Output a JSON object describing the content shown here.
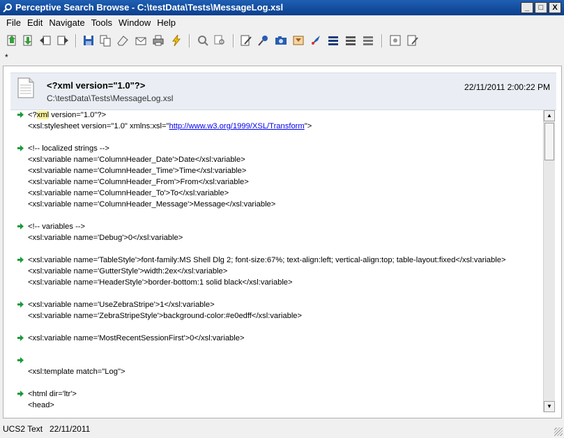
{
  "window": {
    "title": "Perceptive Search Browse - C:\\testData\\Tests\\MessageLog.xsl",
    "controls": [
      "_",
      "□",
      "X"
    ]
  },
  "menu": [
    "File",
    "Edit",
    "Navigate",
    "Tools",
    "Window",
    "Help"
  ],
  "toolbar_icons": [
    "open-icon",
    "save-arrow-icon",
    "back-icon",
    "forward-icon",
    "save-icon",
    "copy-icon",
    "eraser-icon",
    "email-icon",
    "print-icon",
    "lightning-icon",
    "search-icon",
    "find-icon",
    "edit-icon",
    "pin-icon",
    "camera-icon",
    "filter-icon",
    "rocket-icon",
    "list-icon",
    "list2-icon",
    "list3-icon",
    "image-icon",
    "notes-icon"
  ],
  "subline_text": "*",
  "document": {
    "title": "<?xml version=\"1.0\"?>",
    "path": "C:\\testData\\Tests\\MessageLog.xsl",
    "date": "22/11/2011 2:00:22 PM"
  },
  "code_lines": [
    {
      "arrow": true,
      "pre": "<?",
      "hl": "xml",
      "post": " version=\"1.0\"?>"
    },
    {
      "arrow": false,
      "pre": "<xsl:stylesheet version=\"1.0\" xmlns:xsl=\"",
      "link": "http://www.w3.org/1999/XSL/Transform",
      "post": "\">"
    },
    {
      "arrow": false,
      "pre": ""
    },
    {
      "arrow": true,
      "pre": "<!-- localized strings -->"
    },
    {
      "arrow": false,
      "pre": "<xsl:variable name='ColumnHeader_Date'>Date</xsl:variable>"
    },
    {
      "arrow": false,
      "pre": "<xsl:variable name='ColumnHeader_Time'>Time</xsl:variable>"
    },
    {
      "arrow": false,
      "pre": "<xsl:variable name='ColumnHeader_From'>From</xsl:variable>"
    },
    {
      "arrow": false,
      "pre": "<xsl:variable name='ColumnHeader_To'>To</xsl:variable>"
    },
    {
      "arrow": false,
      "pre": "<xsl:variable name='ColumnHeader_Message'>Message</xsl:variable>"
    },
    {
      "arrow": false,
      "pre": ""
    },
    {
      "arrow": true,
      "pre": "<!-- variables -->"
    },
    {
      "arrow": false,
      "pre": "<xsl:variable name='Debug'>0</xsl:variable>"
    },
    {
      "arrow": false,
      "pre": ""
    },
    {
      "arrow": true,
      "pre": "<xsl:variable name='TableStyle'>font-family:MS Shell Dlg 2; font-size:67%; text-align:left; vertical-align:top; table-layout:fixed</xsl:variable>"
    },
    {
      "arrow": false,
      "pre": "<xsl:variable name='GutterStyle'>width:2ex</xsl:variable>"
    },
    {
      "arrow": false,
      "pre": "<xsl:variable name='HeaderStyle'>border-bottom:1 solid black</xsl:variable>"
    },
    {
      "arrow": false,
      "pre": ""
    },
    {
      "arrow": true,
      "pre": "<xsl:variable name='UseZebraStripe'>1</xsl:variable>"
    },
    {
      "arrow": false,
      "pre": "<xsl:variable name='ZebraStripeStyle'>background-color:#e0edff</xsl:variable>"
    },
    {
      "arrow": false,
      "pre": ""
    },
    {
      "arrow": true,
      "pre": "<xsl:variable name='MostRecentSessionFirst'>0</xsl:variable>"
    },
    {
      "arrow": false,
      "pre": ""
    },
    {
      "arrow": true,
      "pre": ""
    },
    {
      "arrow": false,
      "pre": "<xsl:template match=\"Log\">"
    },
    {
      "arrow": false,
      "pre": ""
    },
    {
      "arrow": true,
      "pre": "   <html dir='ltr'>"
    },
    {
      "arrow": false,
      "pre": "   <head>"
    },
    {
      "arrow": false,
      "pre": ""
    }
  ],
  "status": {
    "encoding": "UCS2 Text",
    "date": "22/11/2011"
  },
  "colors": {
    "titlebar": "#0b3f8d",
    "arrow": "#1a9a3a",
    "highlight": "#fff59a",
    "link": "#0000ee"
  }
}
